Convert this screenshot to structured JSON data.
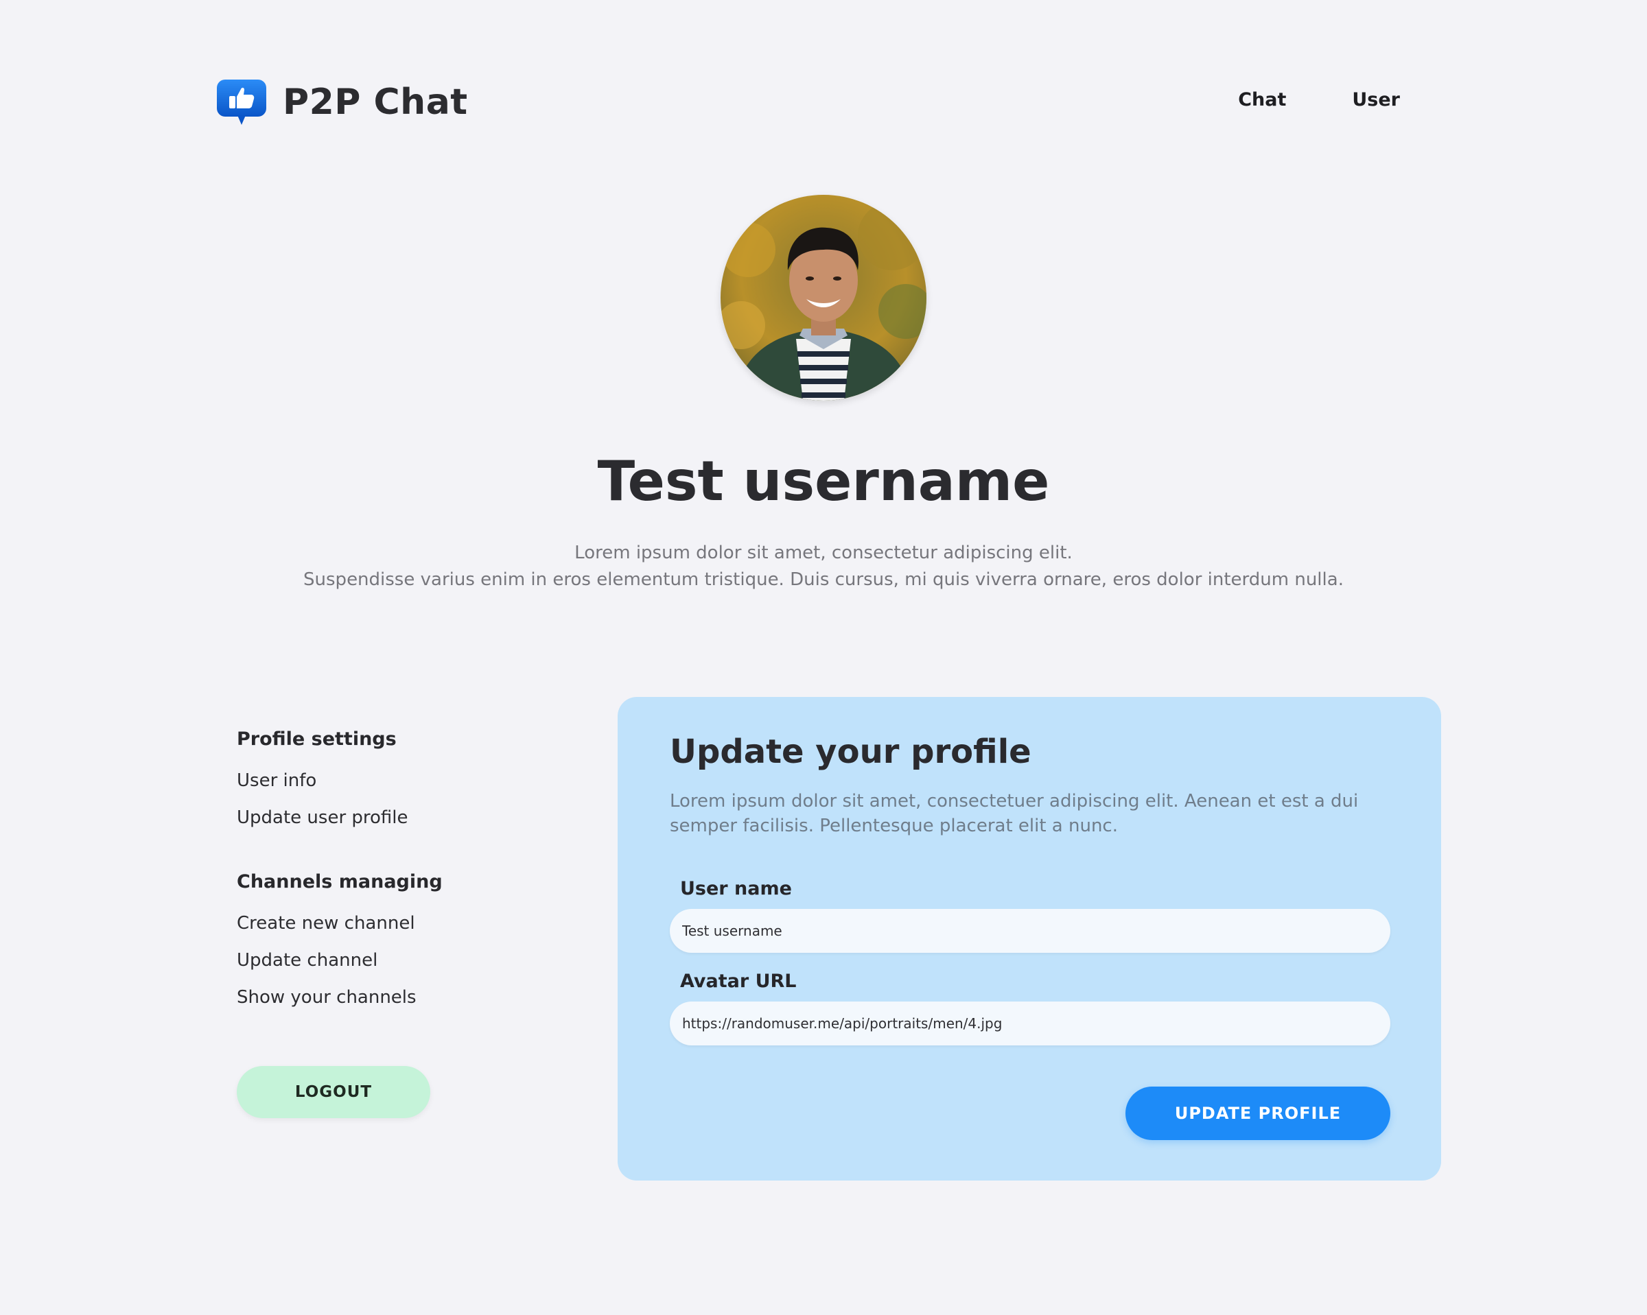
{
  "colors": {
    "page_bg": "#f3f3f7",
    "card_bg": "#c0e2fb",
    "primary_button": "#1d8bf8",
    "logout_button": "#c5f3d9",
    "logo_blue": "#1a73e8"
  },
  "header": {
    "logo_icon": "thumbs-up-chat-bubble-icon",
    "app_title": "P2P Chat",
    "nav": {
      "chat": "Chat",
      "user": "User"
    }
  },
  "hero": {
    "avatar_icon": "user-avatar-photo",
    "username": "Test username",
    "description_line1": "Lorem ipsum dolor sit amet, consectetur adipiscing elit.",
    "description_line2": "Suspendisse varius enim in eros elementum tristique. Duis cursus, mi quis viverra ornare, eros dolor interdum nulla."
  },
  "sidebar": {
    "section1_heading": "Profile settings",
    "section1_items": [
      "User info",
      "Update user profile"
    ],
    "section2_heading": "Channels managing",
    "section2_items": [
      "Create new channel",
      "Update channel",
      "Show your channels"
    ],
    "logout_label": "LOGOUT"
  },
  "profile_form": {
    "title": "Update your profile",
    "description": "Lorem ipsum dolor sit amet, consectetuer adipiscing elit. Aenean et est a dui semper facilisis. Pellentesque placerat elit a nunc.",
    "username_label": "User name",
    "username_value": "Test username",
    "avatar_label": "Avatar URL",
    "avatar_value": "https://randomuser.me/api/portraits/men/4.jpg",
    "submit_label": "UPDATE PROFILE"
  }
}
